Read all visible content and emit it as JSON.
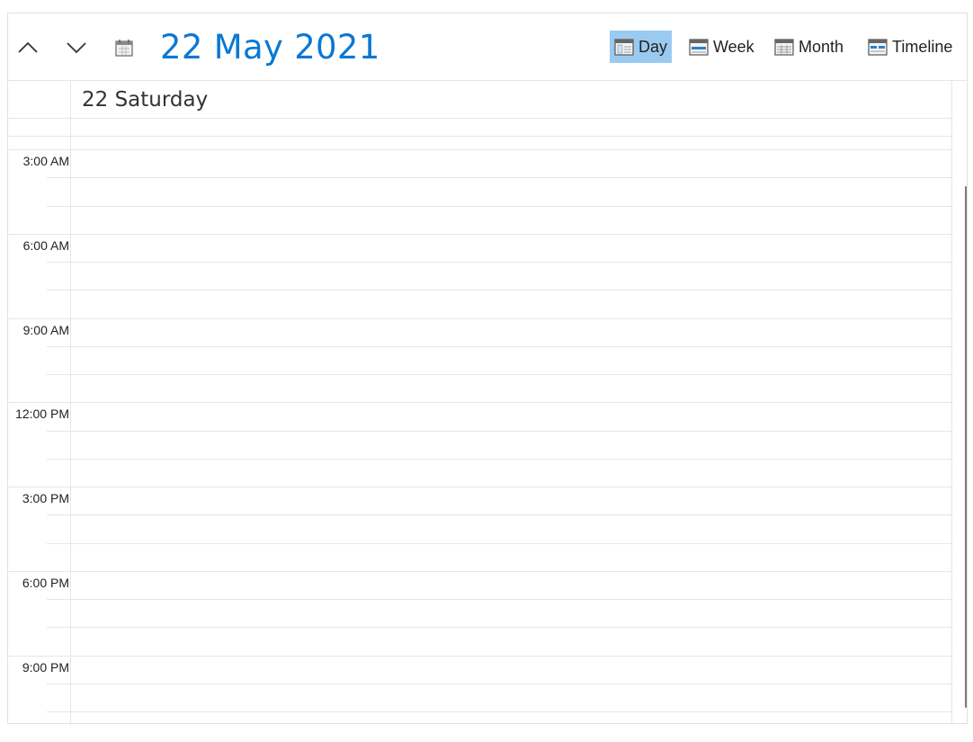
{
  "header": {
    "date_title": "22 May 2021",
    "views": [
      {
        "label": "Day",
        "icon": "day-view-icon",
        "active": true
      },
      {
        "label": "Week",
        "icon": "week-view-icon",
        "active": false
      },
      {
        "label": "Month",
        "icon": "month-view-icon",
        "active": false
      },
      {
        "label": "Timeline",
        "icon": "timeline-view-icon",
        "active": false
      }
    ]
  },
  "day_header": {
    "label": "22 Saturday"
  },
  "time_labels": [
    "3:00 AM",
    "6:00 AM",
    "9:00 AM",
    "12:00 PM",
    "3:00 PM",
    "6:00 PM",
    "9:00 PM"
  ],
  "colors": {
    "accent": "#0a78d4",
    "active_view_bg": "#9bcaf0",
    "grid_line": "#e6e6e6"
  }
}
